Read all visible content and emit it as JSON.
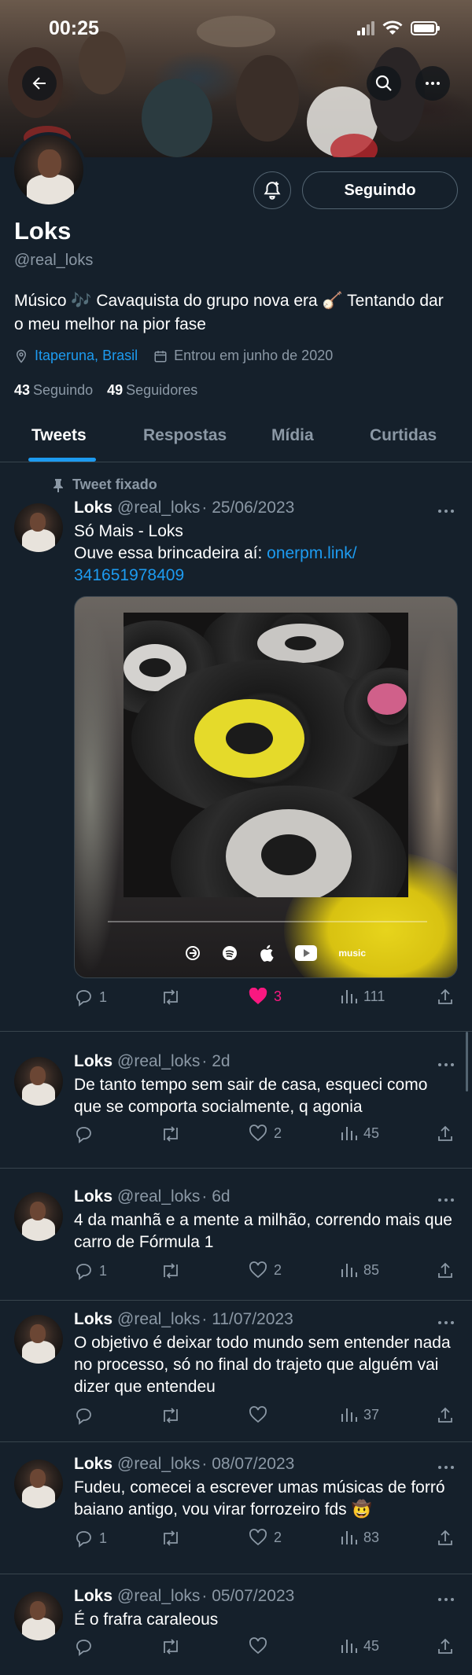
{
  "status_bar": {
    "time": "00:25"
  },
  "profile": {
    "name": "Loks",
    "handle": "@real_loks",
    "bio": "Músico 🎶 Cavaquista do grupo nova era 🪕 Tentando dar o meu melhor na pior fase",
    "location": "Itaperuna, Brasil",
    "joined": "Entrou em junho de 2020",
    "following_count": "43",
    "following_label": "Seguindo",
    "followers_count": "49",
    "followers_label": "Seguidores",
    "follow_button": "Seguindo"
  },
  "tabs": [
    "Tweets",
    "Respostas",
    "Mídia",
    "Curtidas"
  ],
  "active_tab": "Tweets",
  "pinned_label": "Tweet fixado",
  "tweets": [
    {
      "name": "Loks",
      "handle": "@real_loks",
      "date": "· 25/06/2023",
      "text_line1": "Só Mais - Loks",
      "text_line2": "Ouve essa brincadeira aí: ",
      "link": "onerpm.link/",
      "link2": "341651978409",
      "replies": "1",
      "retweets": "",
      "likes": "3",
      "liked": true,
      "views": "111",
      "media_platforms": [
        "deezer",
        "spotify",
        "apple",
        "youtube",
        "music"
      ]
    },
    {
      "name": "Loks",
      "handle": "@real_loks",
      "date": "· 2d",
      "text": "De tanto tempo sem sair de casa, esqueci como que se comporta socialmente, q agonia",
      "replies": "",
      "retweets": "",
      "likes": "2",
      "views": "45"
    },
    {
      "name": "Loks",
      "handle": "@real_loks",
      "date": "· 6d",
      "text": "4 da manhã e a mente a milhão, correndo mais que carro de Fórmula 1",
      "replies": "1",
      "retweets": "",
      "likes": "2",
      "views": "85"
    },
    {
      "name": "Loks",
      "handle": "@real_loks",
      "date": "· 11/07/2023",
      "text": "O objetivo é deixar todo mundo sem entender nada no processo, só no final do trajeto que alguém vai dizer que entendeu",
      "replies": "",
      "retweets": "",
      "likes": "",
      "views": "37"
    },
    {
      "name": "Loks",
      "handle": "@real_loks",
      "date": "· 08/07/2023",
      "text": "Fudeu, comecei a escrever umas músicas de forró baiano antigo, vou virar forrozeiro fds 🤠",
      "replies": "1",
      "retweets": "",
      "likes": "2",
      "views": "83"
    },
    {
      "name": "Loks",
      "handle": "@real_loks",
      "date": "· 05/07/2023",
      "text": "É o frafra caraleous",
      "replies": "",
      "retweets": "",
      "likes": "",
      "views": "45"
    }
  ],
  "colors": {
    "background": "#15202b",
    "accent": "#1d9bf0",
    "like": "#f91880",
    "muted": "#8b98a5",
    "border": "#38444d"
  },
  "icons": [
    "back-arrow-icon",
    "search-icon",
    "more-icon",
    "bell-plus-icon",
    "location-icon",
    "calendar-icon",
    "pin-icon",
    "reply-icon",
    "retweet-icon",
    "like-icon",
    "views-icon",
    "share-icon"
  ]
}
